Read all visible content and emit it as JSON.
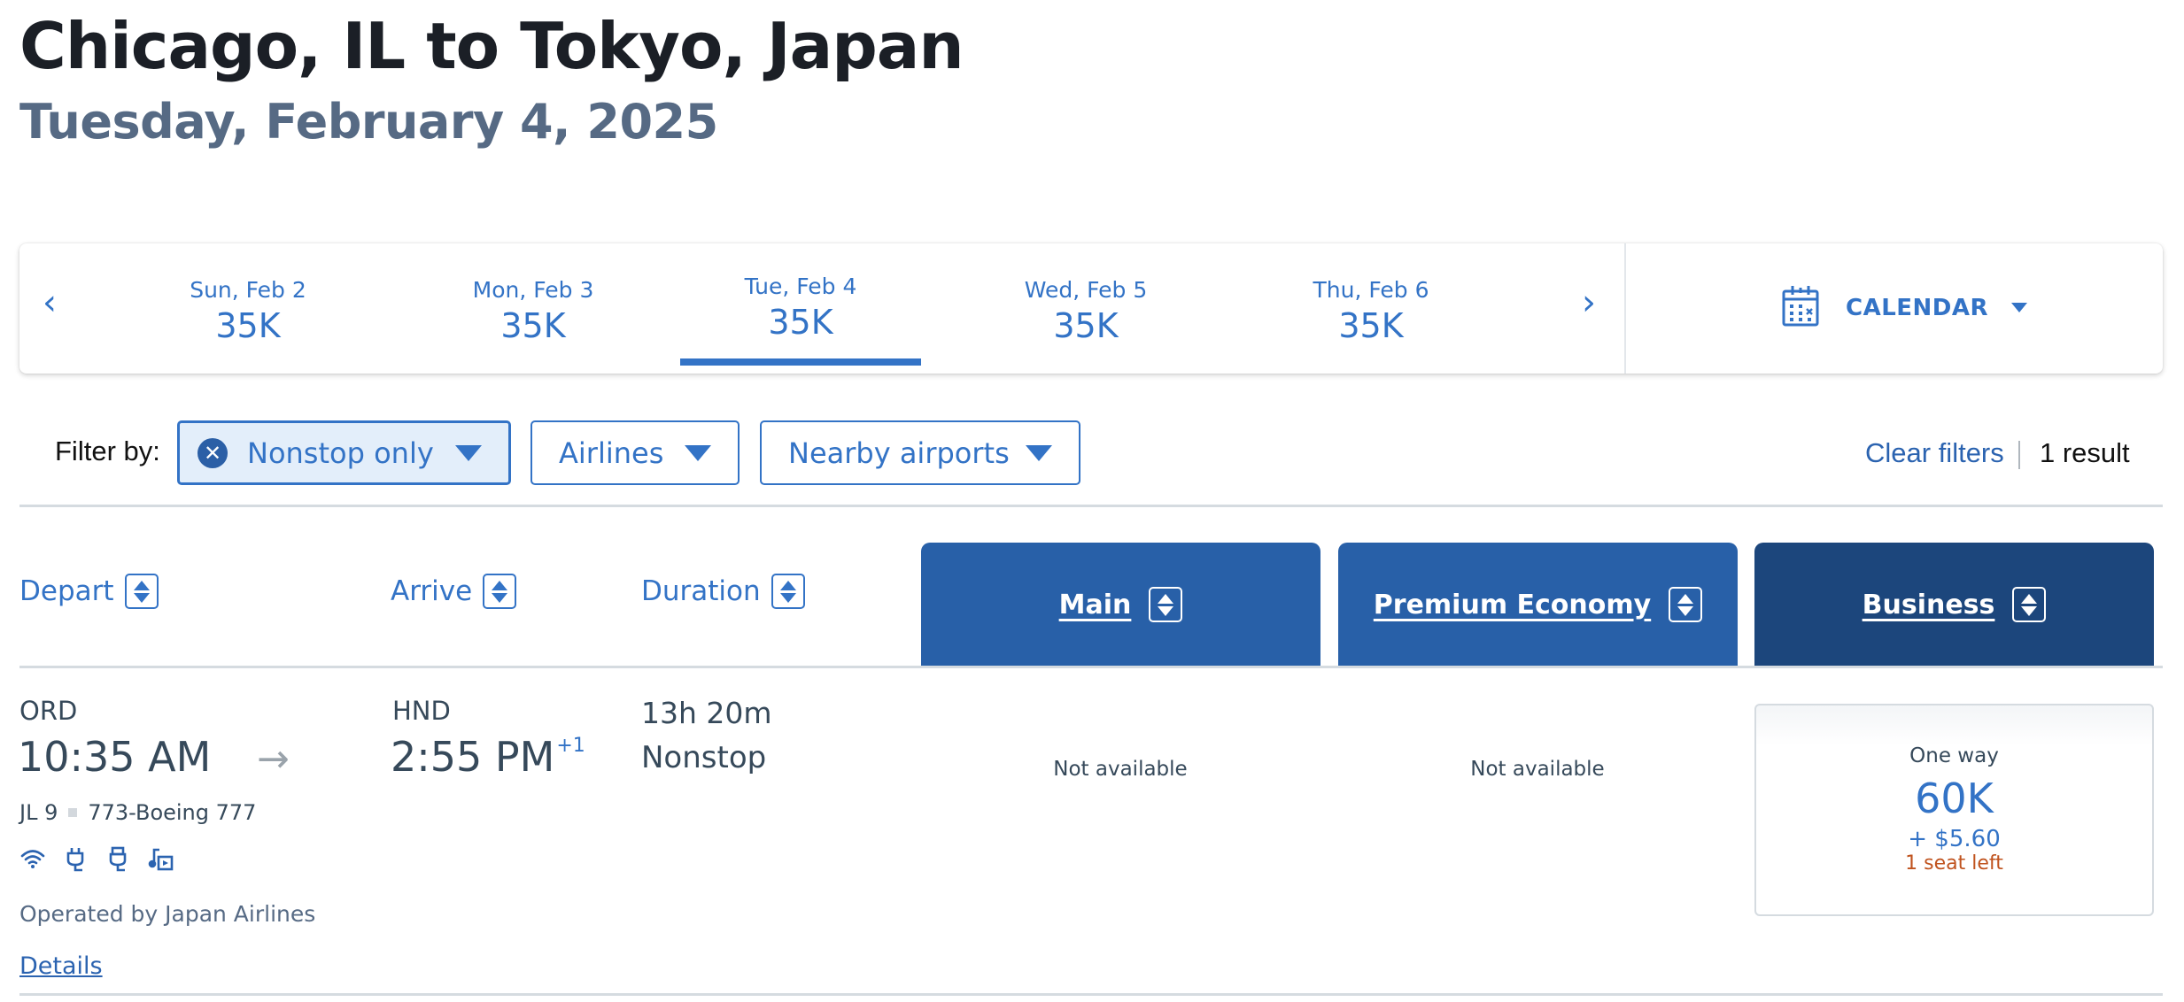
{
  "header": {
    "title": "Chicago, IL to Tokyo, Japan",
    "subtitle": "Tuesday, February 4, 2025"
  },
  "date_strip": {
    "prev_icon": "‹",
    "next_icon": "›",
    "dates": [
      {
        "label": "Sun, Feb 2",
        "price": "35K",
        "selected": false
      },
      {
        "label": "Mon, Feb 3",
        "price": "35K",
        "selected": false
      },
      {
        "label": "Tue, Feb 4",
        "price": "35K",
        "selected": true
      },
      {
        "label": "Wed, Feb 5",
        "price": "35K",
        "selected": false
      },
      {
        "label": "Thu, Feb 6",
        "price": "35K",
        "selected": false
      }
    ],
    "calendar_label": "CALENDAR"
  },
  "filters": {
    "label": "Filter by:",
    "chips": [
      {
        "label": "Nonstop only",
        "active": true,
        "clear_icon": "✕"
      },
      {
        "label": "Airlines",
        "active": false
      },
      {
        "label": "Nearby airports",
        "active": false
      }
    ],
    "clear_label": "Clear filters",
    "result_count": "1 result"
  },
  "columns": {
    "depart": "Depart",
    "arrive": "Arrive",
    "duration": "Duration",
    "cabins": [
      {
        "label": "Main",
        "color": "#2860a8"
      },
      {
        "label": "Premium Economy",
        "color": "#2860a8"
      },
      {
        "label": "Business",
        "color": "#1c467c"
      }
    ]
  },
  "flights": [
    {
      "origin": "ORD",
      "depart_time": "10:35 AM",
      "arrow": "→",
      "destination": "HND",
      "arrive_time": "2:55 PM",
      "day_offset": "+1",
      "flight_number": "JL 9",
      "aircraft": "773-Boeing 777",
      "amenities": [
        "wifi-icon",
        "power-outlet-icon",
        "usb-icon",
        "entertainment-icon"
      ],
      "operated_by": "Operated by Japan Airlines",
      "details_label": "Details",
      "duration": "13h 20m",
      "stops": "Nonstop",
      "fares": {
        "main": "Not available",
        "premium_economy": "Not available",
        "business": {
          "trip_type": "One way",
          "miles": "60K",
          "taxes": "+ $5.60",
          "seats_left": "1 seat left"
        }
      }
    }
  ],
  "colors": {
    "accent": "#3373c6",
    "cabin_main": "#2860a8",
    "cabin_business": "#1c467c",
    "seats_warning": "#c0531e"
  }
}
